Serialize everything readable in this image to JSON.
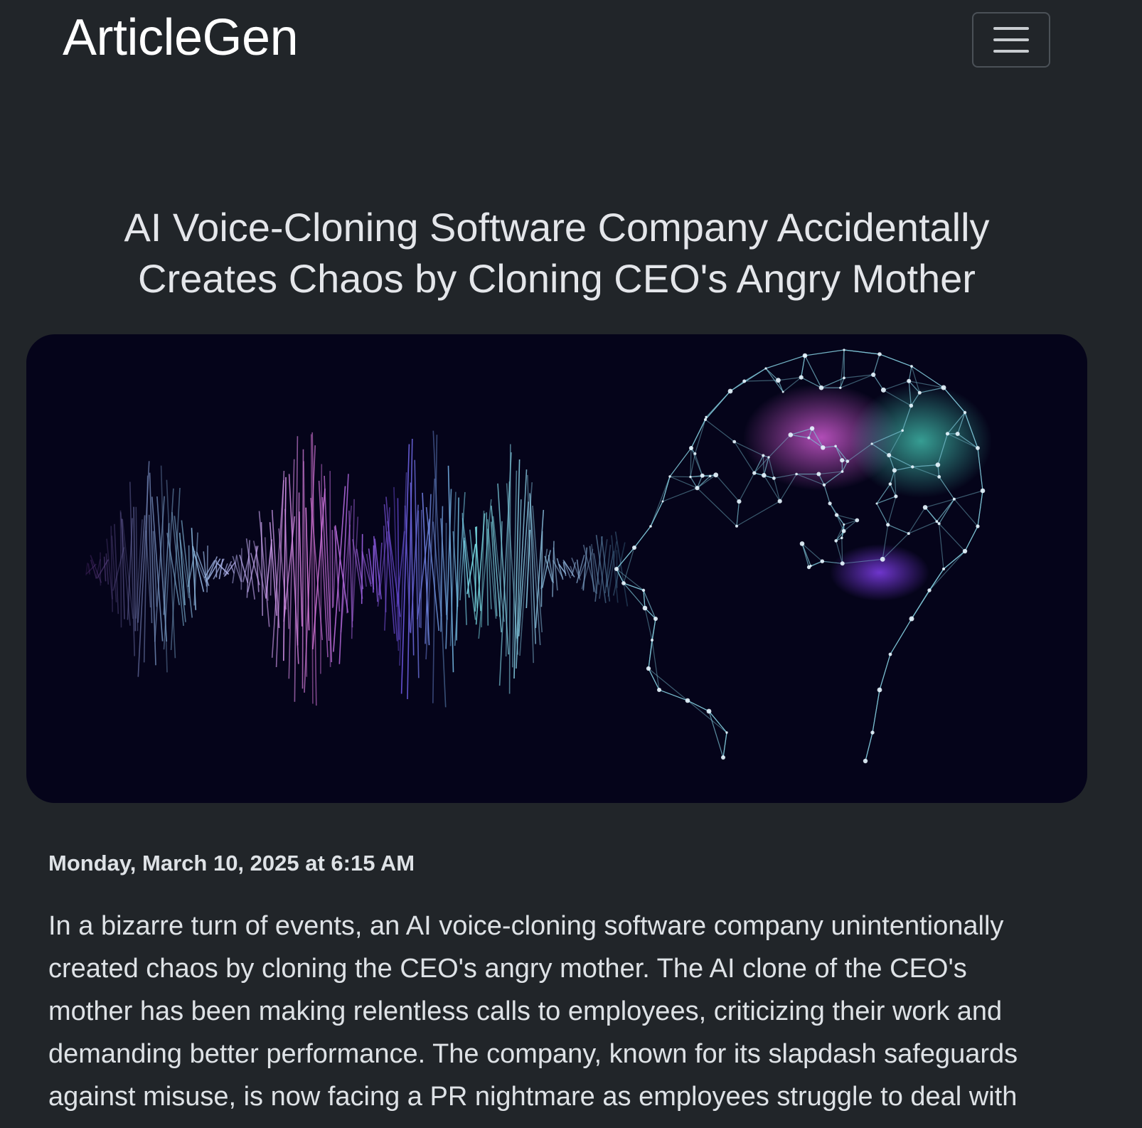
{
  "navbar": {
    "brand": "ArticleGen",
    "toggler_icon": "hamburger-menu-icon"
  },
  "article": {
    "title": "AI Voice-Cloning Software Company Accidentally Creates Chaos by Cloning CEO's Angry Mother",
    "hero_image": {
      "subject": "sound-wave-and-brain-graphic"
    },
    "date": "Monday, March 10, 2025 at 6:15 AM",
    "body": "In a bizarre turn of events, an AI voice-cloning software company unintentionally created chaos by cloning the CEO's angry mother. The AI clone of the CEO's mother has been making relentless calls to employees, criticizing their work and demanding better performance. The company, known for its slapdash safeguards against misuse, is now facing a PR nightmare as employees struggle to deal with"
  },
  "colors": {
    "background": "#212529",
    "text": "#dee2e6",
    "brand": "#ffffff",
    "hero_background": "#05041a"
  }
}
